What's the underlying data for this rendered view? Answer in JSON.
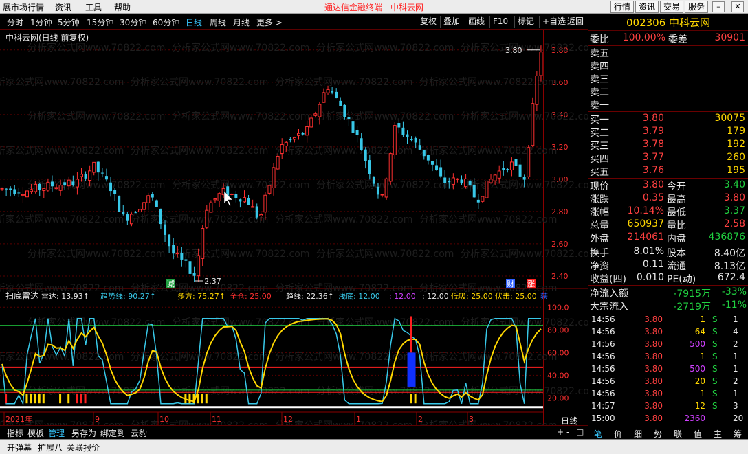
{
  "menu": {
    "items": [
      "展市场行情",
      "资讯",
      "工具",
      "帮助"
    ],
    "promo": [
      "通达信金融终端",
      "中科云网"
    ],
    "right_buttons": [
      "行情",
      "资讯",
      "交易",
      "服务"
    ]
  },
  "periods": {
    "items": [
      "分时",
      "1分钟",
      "5分钟",
      "15分钟",
      "30分钟",
      "60分钟",
      "日线",
      "周线",
      "月线",
      "更多 >"
    ],
    "active": "日线",
    "toolbar": [
      "复权",
      "叠加",
      "画线",
      "F10",
      "标记",
      "+自选",
      "返回"
    ]
  },
  "chart_data": [
    {
      "type": "candlestick",
      "title": "中科云网(日线 前复权)",
      "yticks": [
        "3.80",
        "3.60",
        "3.40",
        "3.20",
        "3.00",
        "2.80",
        "2.60",
        "2.40"
      ],
      "ylim": [
        2.37,
        3.88
      ],
      "high_label": "3.80",
      "low_label": "2.37",
      "markers": [
        "减",
        "财",
        "涨"
      ],
      "xlabels": [
        "2021年",
        "9",
        "10",
        "11",
        "12",
        "1",
        "2",
        "3"
      ],
      "colors": {
        "up": "#ff3030",
        "down": "#38c8e8"
      }
    },
    {
      "type": "line",
      "title": "扫底雷达",
      "legend": [
        {
          "label": "雷达: 13.93↑",
          "color": "#e8e8e8"
        },
        {
          "label": "趋势线: 90.27↑",
          "color": "#38c8e8"
        },
        {
          "label": "多方: 75.27↑",
          "color": "#ffd700"
        },
        {
          "label": "全仓: 25.00",
          "color": "#ff3030"
        },
        {
          "label": "趋线: 22.36↑",
          "color": "#e8e8e8"
        },
        {
          "label": "浅底: 12.00",
          "color": "#38c8e8"
        },
        {
          "label": ": 12.00",
          "color": "#d040ff"
        },
        {
          "label": ": 12.00",
          "color": "#e8e8e8"
        },
        {
          "label": "低吸: 25.00",
          "color": "#ffd700"
        },
        {
          "label": "伏击: 25.00",
          "color": "#ffd700"
        },
        {
          "label": "获",
          "color": "#3060ff"
        }
      ],
      "yticks": [
        "100.0",
        "80.00",
        "60.00",
        "40.00",
        "20.00"
      ],
      "ylim": [
        10,
        105
      ]
    }
  ],
  "right_panel": {
    "header": "002306 中科云网",
    "weibi": {
      "label1": "委比",
      "val1": "100.00%",
      "label2": "委差",
      "val2": "30901"
    },
    "sell": [
      {
        "label": "卖五",
        "price": "",
        "vol": ""
      },
      {
        "label": "卖四",
        "price": "",
        "vol": ""
      },
      {
        "label": "卖三",
        "price": "",
        "vol": ""
      },
      {
        "label": "卖二",
        "price": "",
        "vol": ""
      },
      {
        "label": "卖一",
        "price": "",
        "vol": ""
      }
    ],
    "buy": [
      {
        "label": "买一",
        "price": "3.80",
        "vol": "30075"
      },
      {
        "label": "买二",
        "price": "3.79",
        "vol": "179"
      },
      {
        "label": "买三",
        "price": "3.78",
        "vol": "192"
      },
      {
        "label": "买四",
        "price": "3.77",
        "vol": "260"
      },
      {
        "label": "买五",
        "price": "3.76",
        "vol": "195"
      }
    ],
    "quote": [
      {
        "l1": "现价",
        "v1": "3.80",
        "c1": "red",
        "l2": "今开",
        "v2": "3.40",
        "c2": "grn"
      },
      {
        "l1": "涨跌",
        "v1": "0.35",
        "c1": "red",
        "l2": "最高",
        "v2": "3.80",
        "c2": "red"
      },
      {
        "l1": "涨幅",
        "v1": "10.14%",
        "c1": "red",
        "l2": "最低",
        "v2": "3.37",
        "c2": "grn"
      },
      {
        "l1": "总量",
        "v1": "650937",
        "c1": "yel",
        "l2": "量比",
        "v2": "2.58",
        "c2": "red"
      },
      {
        "l1": "外盘",
        "v1": "214061",
        "c1": "red",
        "l2": "内盘",
        "v2": "436876",
        "c2": "grn"
      }
    ],
    "fin": [
      {
        "l1": "换手",
        "v1": "8.01%",
        "l2": "股本",
        "v2": "8.40亿"
      },
      {
        "l1": "净资",
        "v1": "0.11",
        "l2": "流通",
        "v2": "8.13亿"
      },
      {
        "l1": "收益(四)",
        "v1": "0.010",
        "l2": "PE(动)",
        "v2": "672.4"
      }
    ],
    "flow": [
      {
        "label": "净流入额",
        "v1": "-7915万",
        "v2": "-33%"
      },
      {
        "label": "大宗流入",
        "v1": "-2719万",
        "v2": "-11%"
      }
    ],
    "ticks": [
      {
        "t": "14:56",
        "p": "3.80",
        "v": "1",
        "vc": "yel",
        "s": "S",
        "n": "1"
      },
      {
        "t": "14:56",
        "p": "3.80",
        "v": "64",
        "vc": "yel",
        "s": "S",
        "n": "4"
      },
      {
        "t": "14:56",
        "p": "3.80",
        "v": "500",
        "vc": "mag",
        "s": "S",
        "n": "2"
      },
      {
        "t": "14:56",
        "p": "3.80",
        "v": "1",
        "vc": "yel",
        "s": "S",
        "n": "1"
      },
      {
        "t": "14:56",
        "p": "3.80",
        "v": "500",
        "vc": "mag",
        "s": "S",
        "n": "1"
      },
      {
        "t": "14:56",
        "p": "3.80",
        "v": "20",
        "vc": "yel",
        "s": "S",
        "n": "2"
      },
      {
        "t": "14:56",
        "p": "3.80",
        "v": "1",
        "vc": "yel",
        "s": "S",
        "n": "1"
      },
      {
        "t": "14:57",
        "p": "3.80",
        "v": "12",
        "vc": "yel",
        "s": "S",
        "n": "3"
      },
      {
        "t": "15:00",
        "p": "3.80",
        "v": "2360",
        "vc": "mag",
        "s": "",
        "n": "20"
      }
    ],
    "tabs": [
      "笔",
      "价",
      "细",
      "势",
      "联",
      "值",
      "主",
      "筹"
    ]
  },
  "bottom": {
    "tabs": [
      "指标",
      "模板",
      "管理",
      "另存为",
      "绑定到",
      "云豹"
    ],
    "active": "管理",
    "period_label": "日线",
    "ctrl": [
      "+",
      "-",
      "□"
    ],
    "bar2": [
      "开弹幕",
      "扩展八",
      "关联报价"
    ]
  },
  "watermark": "分析家公式网www.70822.com"
}
